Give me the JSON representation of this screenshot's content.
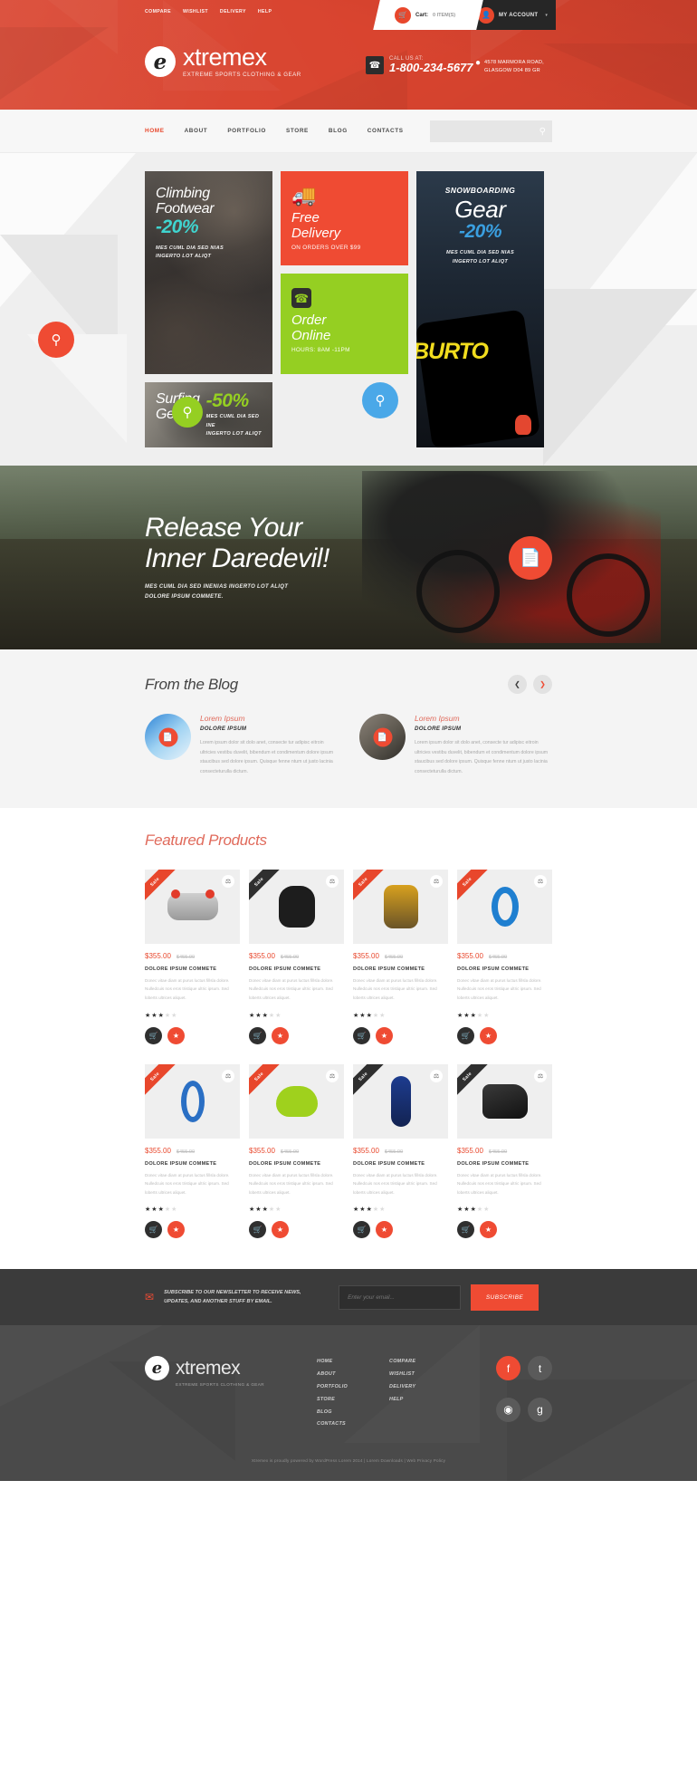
{
  "header": {
    "top_links": [
      "COMPARE",
      "WISHLIST",
      "DELIVERY",
      "HELP"
    ],
    "cart": {
      "icon": "shopping-cart-icon",
      "label": "Cart:",
      "count": "0 ITEM(S)"
    },
    "account": {
      "icon": "user-icon",
      "label": "MY ACCOUNT",
      "caret": "▾"
    },
    "brand": {
      "mark": "e",
      "name": "xtremex",
      "tagline": "EXTREME SPORTS CLOTHING & GEAR"
    },
    "phone": {
      "icon": "phone-icon",
      "label": "CALL US AT:",
      "number": "1-800-234-5677"
    },
    "address": {
      "icon": "map-pin-icon",
      "line1": "4578 MARMORA ROAD,",
      "line2": "GLASGOW D04 89 GR"
    }
  },
  "nav": {
    "items": [
      {
        "label": "HOME",
        "active": true
      },
      {
        "label": "ABOUT",
        "active": false
      },
      {
        "label": "PORTFOLIO",
        "active": false
      },
      {
        "label": "STORE",
        "active": false
      },
      {
        "label": "BLOG",
        "active": false
      },
      {
        "label": "CONTACTS",
        "active": false
      }
    ],
    "search": {
      "icon": "search-icon",
      "placeholder": ""
    }
  },
  "tiles": {
    "climbing": {
      "title_line1": "Climbing",
      "title_line2": "Footwear",
      "discount": "-20%",
      "sub_line1": "MES CUML DIA SED NIAS",
      "sub_line2": "INGERTO LOT ALIQT",
      "accent": "#3fd4cf",
      "search_icon": "search-icon"
    },
    "free_delivery": {
      "icon": "delivery-truck-icon",
      "title_line1": "Free",
      "title_line2": "Delivery",
      "sub": "ON ORDERS OVER $99",
      "bg": "#ef4b33"
    },
    "order_online": {
      "icon": "phone-icon",
      "title_line1": "Order",
      "title_line2": "Online",
      "sub": "HOURS: 8AM -11PM",
      "bg": "#95cf22"
    },
    "surfing": {
      "title_line1": "Surfing",
      "title_line2": "Gear",
      "discount": "-50%",
      "sub_line1": "MES CUML DIA SED INE",
      "sub_line2": "INGERTO LOT ALIQT",
      "accent": "#95cf22",
      "search_icon": "search-icon"
    },
    "snowboarding": {
      "eyebrow": "SNOWBOARDING",
      "title": "Gear",
      "discount": "-20%",
      "sub_line1": "MES CUML DIA SED NIAS",
      "sub_line2": "INGERTO LOT ALIQT",
      "brand_art": "BURTO",
      "accent": "#3a9fe0",
      "search_icon": "search-icon"
    }
  },
  "daredevil": {
    "heading_line1": "Release Your",
    "heading_line2": "Inner Daredevil!",
    "sub_line1": "MES CUML DIA SED INENIAS INGERTO LOT ALIQT",
    "sub_line2": "DOLORE IPSUM COMMETE.",
    "button_icon": "document-icon"
  },
  "blog": {
    "title": "From the Blog",
    "prev_icon": "chevron-left-icon",
    "next_icon": "chevron-right-icon",
    "posts": [
      {
        "title": "Lorem Ipsum",
        "subtitle": "DOLORE IPSUM",
        "text": "Lorem ipsum dolor sit dolo anet, consecte tur adipisc eitroin ultricies vestibu duvelit, bibendum et condimentum dolore ipsum staucibus sed dolore ipsum. Quisque fenne ntum ut justo lacinia consecteturulla dictum.",
        "badge_icon": "document-icon"
      },
      {
        "title": "Lorem Ipsum",
        "subtitle": "DOLORE IPSUM",
        "text": "Lorem ipsum dolor sit dolo anet, consecte tur adipisc eitroin ultricies vestibu duvelit, bibendum et condimentum dolore ipsum staucibus sed dolore ipsum. Quisque fenne ntum ut justo lacinia consecteturulla dictum.",
        "badge_icon": "document-icon"
      }
    ]
  },
  "featured": {
    "title": "Featured Products",
    "ribbon_label": "Sale",
    "compare_icon": "compare-icon",
    "cart_icon": "shopping-cart-icon",
    "fav_icon": "star-icon",
    "products": [
      {
        "ribbon": "red",
        "shape": "sh-helmet",
        "price": "$355.00",
        "old_price": "$455.00",
        "name": "DOLORE IPSUM COMMETE",
        "desc": "Donec vitae diam at purus luctus fillsla dolore. Nulledcuis nos eros tristique ultric ipsum. Sed loberts ultrices aliquet.",
        "rating": 3
      },
      {
        "ribbon": "dark",
        "shape": "sh-backpack",
        "price": "$355.00",
        "old_price": "$455.00",
        "name": "DOLORE IPSUM COMMETE",
        "desc": "Donec vitae diam at purus luctus fillsla dolore. Nulledcuis nos eros tristique ultric ipsum. Sed loberts ultrices aliquet.",
        "rating": 3
      },
      {
        "ribbon": "red",
        "shape": "sh-pack2",
        "price": "$355.00",
        "old_price": "$455.00",
        "name": "DOLORE IPSUM COMMETE",
        "desc": "Donec vitae diam at purus luctus fillsla dolore. Nulledcuis nos eros tristique ultric ipsum. Sed loberts ultrices aliquet.",
        "rating": 3
      },
      {
        "ribbon": "red",
        "shape": "sh-carab-blue",
        "price": "$355.00",
        "old_price": "$455.00",
        "name": "DOLORE IPSUM COMMETE",
        "desc": "Donec vitae diam at purus luctus fillsla dolore. Nulledcuis nos eros tristique ultric ipsum. Sed loberts ultrices aliquet.",
        "rating": 3
      },
      {
        "ribbon": "red",
        "shape": "sh-carab",
        "price": "$355.00",
        "old_price": "$455.00",
        "name": "DOLORE IPSUM COMMETE",
        "desc": "Donec vitae diam at purus luctus fillsla dolore. Nulledcuis nos eros tristique ultric ipsum. Sed loberts ultrices aliquet.",
        "rating": 3
      },
      {
        "ribbon": "red",
        "shape": "sh-helmet2",
        "price": "$355.00",
        "old_price": "$455.00",
        "name": "DOLORE IPSUM COMMETE",
        "desc": "Donec vitae diam at purus luctus fillsla dolore. Nulledcuis nos eros tristique ultric ipsum. Sed loberts ultrices aliquet.",
        "rating": 3
      },
      {
        "ribbon": "dark",
        "shape": "sh-suit",
        "price": "$355.00",
        "old_price": "$455.00",
        "name": "DOLORE IPSUM COMMETE",
        "desc": "Donec vitae diam at purus luctus fillsla dolore. Nulledcuis nos eros tristique ultric ipsum. Sed loberts ultrices aliquet.",
        "rating": 3
      },
      {
        "ribbon": "dark",
        "shape": "sh-boot",
        "price": "$355.00",
        "old_price": "$455.00",
        "name": "DOLORE IPSUM COMMETE",
        "desc": "Donec vitae diam at purus luctus fillsla dolore. Nulledcuis nos eros tristique ultric ipsum. Sed loberts ultrices aliquet.",
        "rating": 3
      }
    ]
  },
  "newsletter": {
    "icon": "envelope-icon",
    "text_line1": "SUBSCRIBE TO OUR NEWSLETTER TO RECEIVE NEWS,",
    "text_line2": "UPDATES, AND ANOTHER STUFF BY EMAIL.",
    "placeholder": "Enter your email...",
    "value": "",
    "button": "SUBSCRIBE"
  },
  "footer": {
    "brand": {
      "mark": "e",
      "name": "xtremex",
      "tagline": "EXTREME SPORTS CLOTHING & GEAR"
    },
    "col1": [
      "HOME",
      "ABOUT",
      "PORTFOLIO",
      "STORE",
      "BLOG",
      "CONTACTS"
    ],
    "col2": [
      "COMPARE",
      "WISHLIST",
      "DELIVERY",
      "HELP"
    ],
    "social": [
      {
        "name": "facebook",
        "glyph": "f"
      },
      {
        "name": "twitter",
        "glyph": "t"
      },
      {
        "name": "instagram",
        "glyph": "◉"
      },
      {
        "name": "google-plus",
        "glyph": "g"
      }
    ],
    "copyright": "Xtremex is proudly powered by WordPress Lorem 2014 | Lorem Downloads | Web Privacy Policy"
  },
  "colors": {
    "brand_red": "#e8472c",
    "tile_red": "#ef4b33",
    "green": "#95cf22",
    "cyan": "#3fd4cf",
    "blue": "#3a9fe0",
    "dark": "#2f2f2f"
  }
}
